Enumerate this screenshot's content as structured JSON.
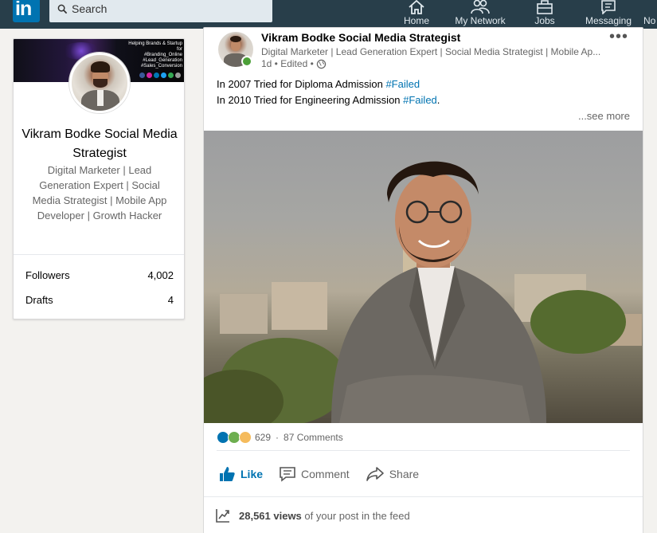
{
  "nav": {
    "logo_text": "in",
    "search_placeholder": "Search",
    "items": [
      {
        "label": "Home",
        "icon": "home-icon"
      },
      {
        "label": "My Network",
        "icon": "network-icon"
      },
      {
        "label": "Jobs",
        "icon": "jobs-icon"
      },
      {
        "label": "Messaging",
        "icon": "messaging-icon"
      },
      {
        "label": "No"
      }
    ]
  },
  "profile": {
    "banner_text": "Helping Brands & Startup\nfor\n#Branding_Online\n#Lead_Generation\n#Sales_Conversion",
    "name": "Vikram Bodke Social Media Strategist",
    "headline": "Digital Marketer | Lead Generation Expert | Social Media Strategist | Mobile App Developer | Growth Hacker",
    "stats": [
      {
        "label": "Followers",
        "value": "4,002"
      },
      {
        "label": "Drafts",
        "value": "4"
      }
    ]
  },
  "post": {
    "author": "Vikram Bodke Social Media Strategist",
    "author_headline": "Digital Marketer | Lead Generation Expert | Social Media Strategist | Mobile Ap...",
    "meta": "1d • Edited •",
    "line1_text": "In 2007 Tried for Diploma Admission ",
    "line1_tag": "#Failed",
    "line2_text": "In 2010 Tried for Engineering Admission ",
    "line2_tag": "#Failed",
    "line2_end": ".",
    "see_more": "...see more",
    "reactions_count": "629",
    "comments": "87 Comments",
    "actions": {
      "like": "Like",
      "comment": "Comment",
      "share": "Share"
    },
    "views_count": "28,561 views",
    "views_suffix": "of your post in the feed"
  },
  "colors": {
    "accent": "#0073b1",
    "nav_bg": "#283e4a",
    "online": "#4c9f38"
  }
}
